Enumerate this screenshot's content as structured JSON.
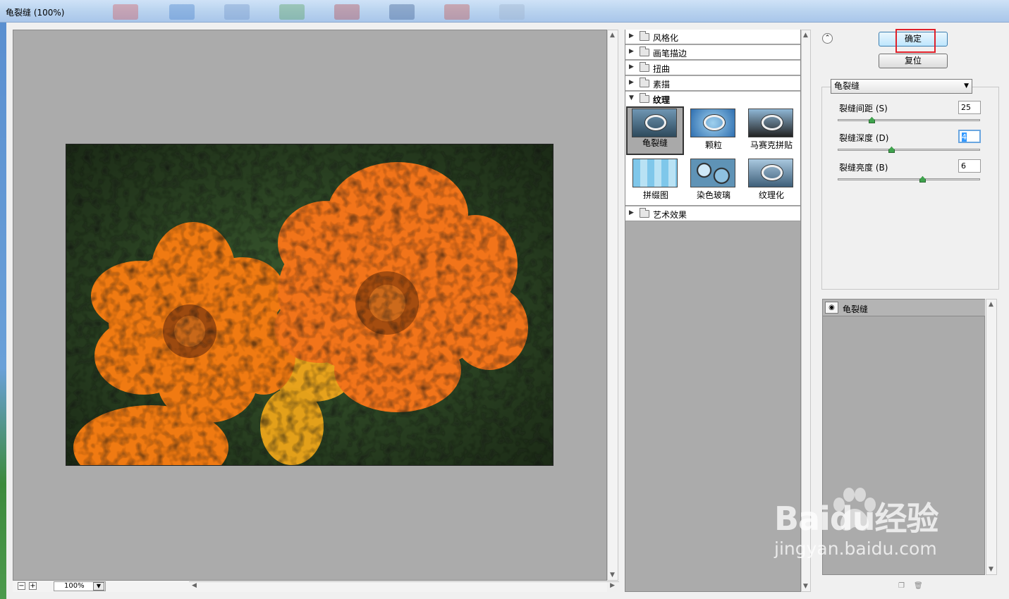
{
  "window": {
    "title": "龟裂缝 (100%)"
  },
  "preview": {
    "zoom": "100%"
  },
  "gallery": {
    "categories": [
      {
        "label": "风格化",
        "open": false
      },
      {
        "label": "画笔描边",
        "open": false
      },
      {
        "label": "扭曲",
        "open": false
      },
      {
        "label": "素描",
        "open": false
      },
      {
        "label": "纹理",
        "open": true
      },
      {
        "label": "艺术效果",
        "open": false
      }
    ],
    "texture_filters": [
      {
        "label": "龟裂缝",
        "selected": true
      },
      {
        "label": "颗粒",
        "selected": false
      },
      {
        "label": "马赛克拼贴",
        "selected": false
      },
      {
        "label": "拼缀图",
        "selected": false
      },
      {
        "label": "染色玻璃",
        "selected": false
      },
      {
        "label": "纹理化",
        "selected": false
      }
    ]
  },
  "buttons": {
    "ok": "确定",
    "reset": "复位"
  },
  "settings": {
    "filter_select": "龟裂缝",
    "params": [
      {
        "label": "裂缝间距 (S)",
        "value": "25",
        "level": 0.24
      },
      {
        "label": "裂缝深度 (D)",
        "value": "4",
        "level": 0.38
      },
      {
        "label": "裂缝亮度 (B)",
        "value": "6",
        "level": 0.6
      }
    ]
  },
  "layers": {
    "items": [
      {
        "label": "龟裂缝"
      }
    ]
  },
  "watermark": {
    "brand": "Baidu经验",
    "url": "jingyan.baidu.com"
  },
  "colors": {
    "highlight": "#e0202a",
    "slider_handle": "#3fa34d"
  }
}
